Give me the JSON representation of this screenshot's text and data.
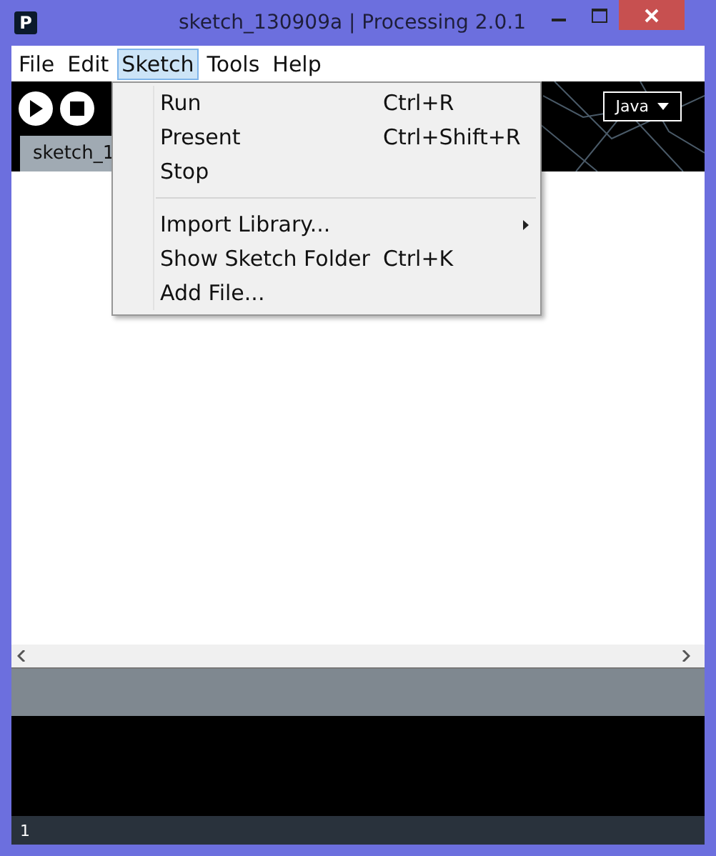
{
  "window": {
    "title": "sketch_130909a | Processing 2.0.1",
    "logo": "P"
  },
  "menubar": [
    {
      "label": "File",
      "selected": false
    },
    {
      "label": "Edit",
      "selected": false
    },
    {
      "label": "Sketch",
      "selected": true
    },
    {
      "label": "Tools",
      "selected": false
    },
    {
      "label": "Help",
      "selected": false
    }
  ],
  "menu": [
    {
      "kind": "item",
      "label": "Run",
      "shortcut": "Ctrl+R"
    },
    {
      "kind": "item",
      "label": "Present",
      "shortcut": "Ctrl+Shift+R"
    },
    {
      "kind": "item",
      "label": "Stop"
    },
    {
      "kind": "separator"
    },
    {
      "kind": "submenu",
      "label": "Import Library..."
    },
    {
      "kind": "item",
      "label": "Show Sketch Folder",
      "shortcut": "Ctrl+K"
    },
    {
      "kind": "item",
      "label": "Add File..."
    }
  ],
  "mode": {
    "label": "Java"
  },
  "tabs": [
    {
      "label": "sketch_1",
      "selected": true
    }
  ],
  "status_bar": {
    "line": "1"
  }
}
